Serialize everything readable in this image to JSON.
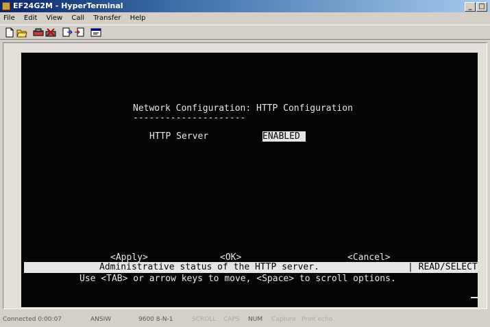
{
  "window": {
    "title": "EF24G2M - HyperTerminal"
  },
  "menu": [
    "File",
    "Edit",
    "View",
    "Call",
    "Transfer",
    "Help"
  ],
  "toolbar_icons": [
    "new-icon",
    "open-icon",
    "connect-icon",
    "disconnect-icon",
    "send-icon",
    "receive-icon",
    "properties-icon"
  ],
  "terminal": {
    "heading": "Network Configuration: HTTP Configuration",
    "underline": "---------------------",
    "field_label": "HTTP Server          :",
    "field_value": "ENABLED",
    "actions": {
      "apply": "<Apply>",
      "ok": "<OK>",
      "cancel": "<Cancel>"
    },
    "help_text": "Administrative status of the HTTP server.",
    "mode": "| READ/SELECT",
    "hint": "Use <TAB> or arrow keys to move, <Space> to scroll options."
  },
  "statusbar": {
    "connected": "Connected 0:00:07",
    "emulation": "ANSIW",
    "settings": "9600 8-N-1",
    "scroll": "SCROLL",
    "caps": "CAPS",
    "num": "NUM",
    "capture": "Capture",
    "print_echo": "Print echo"
  }
}
